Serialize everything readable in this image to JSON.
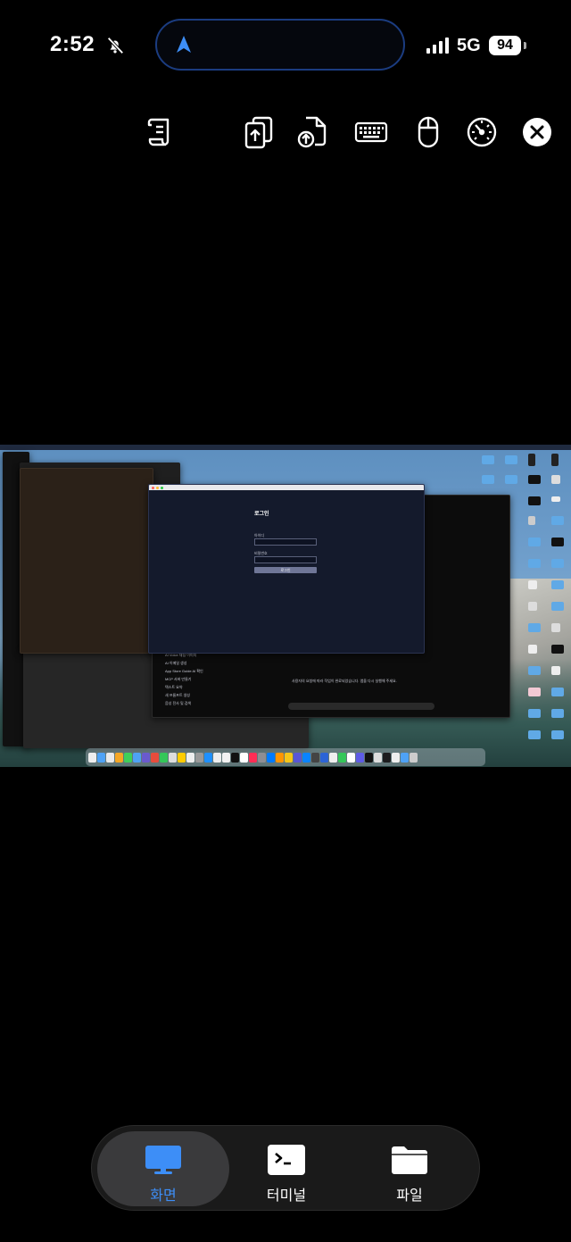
{
  "status_bar": {
    "time": "2:52",
    "network": "5G",
    "battery": "94",
    "icons": [
      "bell-slash-icon",
      "location-arrow-icon",
      "signal-bars-icon",
      "battery-icon"
    ]
  },
  "toolbar": {
    "icons": [
      "script-scroll-icon",
      "upload-copy-icon",
      "upload-file-icon",
      "keyboard-icon",
      "mouse-icon",
      "speedometer-icon",
      "close-icon"
    ]
  },
  "remote_screen": {
    "login_window": {
      "title": "로그인",
      "username_label": "아이디",
      "password_label": "비밀번호",
      "button_label": "로그인"
    },
    "chat_window": {
      "sidebar_items": [
        "AI Voice 채팅 이미지",
        "AI 이메일 생성",
        "App Store Guide AI 확인",
        "MCP 서버 만들기",
        "텍스트 요약",
        "새 프롬프트 생성",
        "음성 전사 및 검색"
      ],
      "message": "사용자의 요청에 따라 작업이 완료되었습니다. 앱을 다시 실행해 주세요."
    }
  },
  "tabs": [
    {
      "label": "화면",
      "icon": "monitor-icon",
      "active": true
    },
    {
      "label": "터미널",
      "icon": "terminal-icon",
      "active": false
    },
    {
      "label": "파일",
      "icon": "folder-icon",
      "active": false
    }
  ],
  "colors": {
    "background": "#000000",
    "accent_blue": "#3d8ef7",
    "island_border": "#1b3c80",
    "tabbar_bg": "#1a1a1a",
    "active_tab_bg": "#3a3a3c"
  }
}
